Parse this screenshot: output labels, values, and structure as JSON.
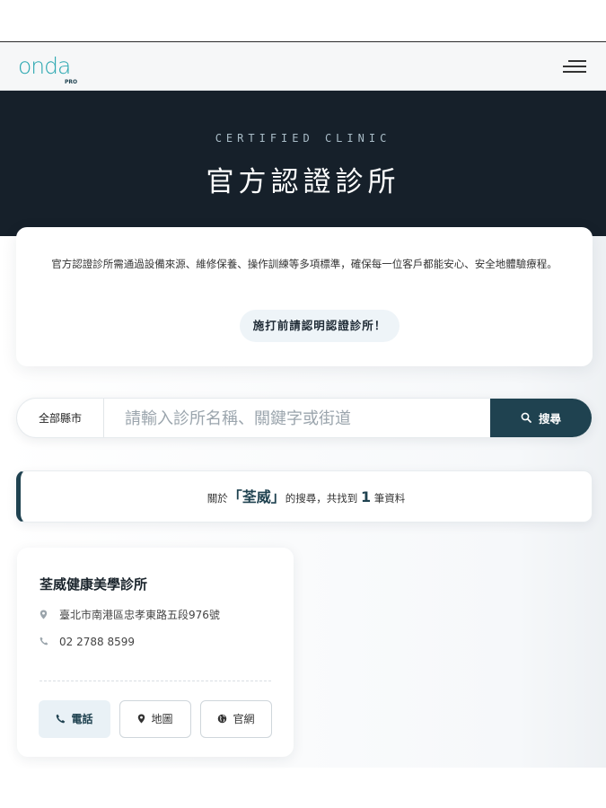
{
  "header": {
    "logo_text": "onda",
    "logo_sub": "PRO",
    "menu_icon": "hamburger-menu-icon"
  },
  "hero": {
    "eyebrow": "CERTIFIED CLINIC",
    "title": "官方認證診所"
  },
  "intro": {
    "text": "官方認證診所需通過設備來源、維修保養、操作訓練等多項標準，確保每一位客戶都能安心、安全地體驗療程。",
    "cta": "施打前請認明認證診所！"
  },
  "search": {
    "city_label": "全部縣市",
    "placeholder": "請輸入診所名稱、關鍵字或街道",
    "button_label": "搜尋",
    "button_icon": "search-icon"
  },
  "result": {
    "prefix": "關於",
    "keyword": "「荃威」",
    "middle": "的搜尋，共找到",
    "count": "1",
    "suffix": "筆資料"
  },
  "clinic": {
    "name": "荃威健康美學診所",
    "address": "臺北市南港區忠孝東路五段976號",
    "phone": "02 2788 8599",
    "buttons": {
      "phone": "電話",
      "map": "地圖",
      "website": "官網"
    }
  },
  "colors": {
    "hero_bg": "#16202a",
    "accent": "#1f4250",
    "brand_teal": "#2aa7b0"
  }
}
